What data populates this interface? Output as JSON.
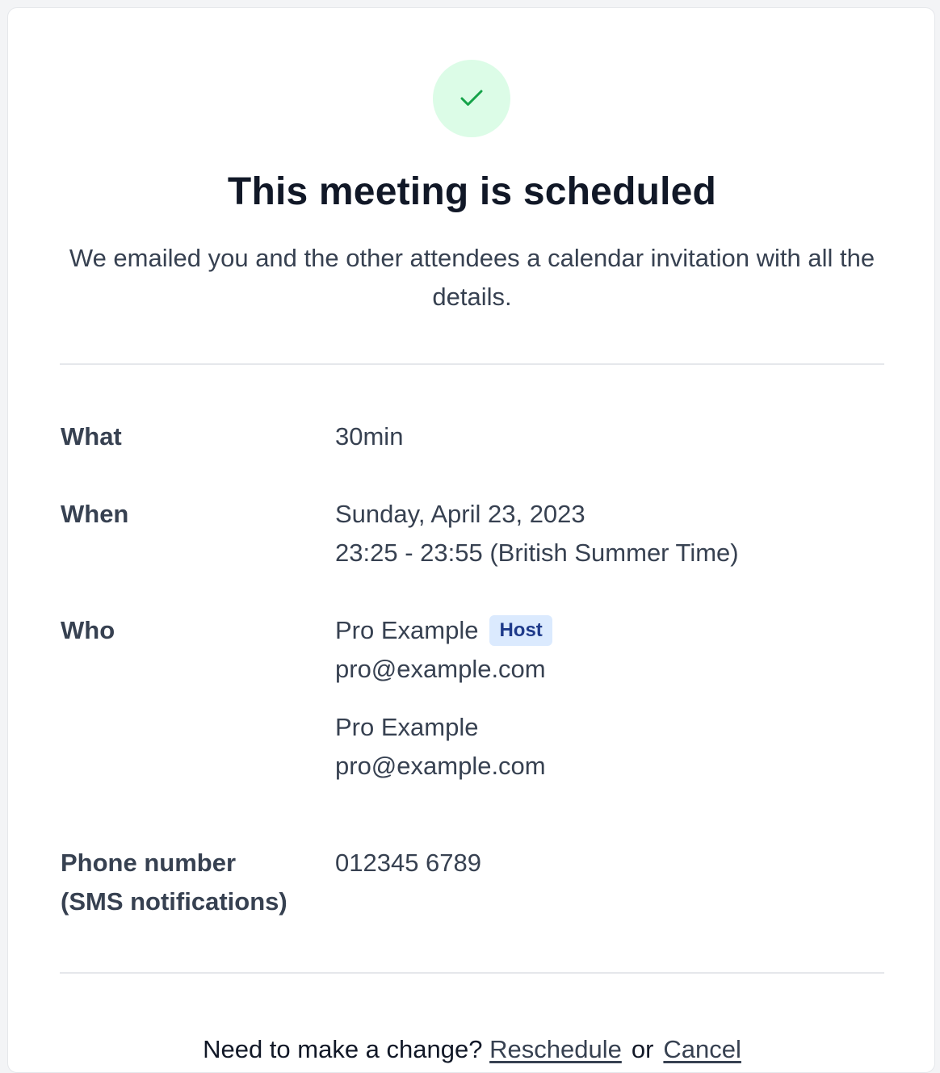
{
  "header": {
    "icon": "check-icon",
    "title": "This meeting is scheduled",
    "subtitle": "We emailed you and the other attendees a calendar invitation with all the details.",
    "accent_color": "#16a34a",
    "icon_bg_color": "#dcfce7"
  },
  "details": {
    "what": {
      "label": "What",
      "value": "30min"
    },
    "when": {
      "label": "When",
      "date": "Sunday, April 23, 2023",
      "time": "23:25 - 23:55 (British Summer Time)"
    },
    "who": {
      "label": "Who",
      "attendees": [
        {
          "name": "Pro Example",
          "email": "pro@example.com",
          "badge": "Host"
        },
        {
          "name": "Pro Example",
          "email": "pro@example.com"
        }
      ]
    },
    "phone": {
      "label_line1": "Phone number",
      "label_line2": "(SMS notifications)",
      "value": "012345 6789"
    }
  },
  "footer": {
    "prompt": "Need to make a change?",
    "reschedule_label": "Reschedule",
    "or_text": "or",
    "cancel_label": "Cancel"
  }
}
